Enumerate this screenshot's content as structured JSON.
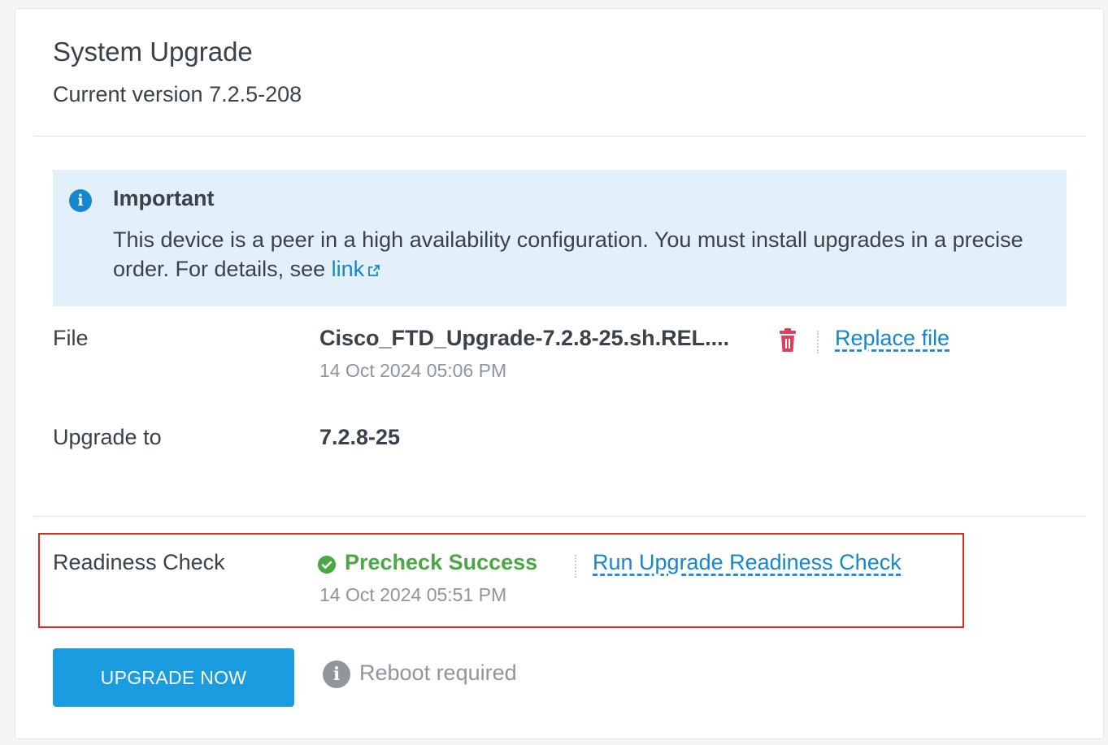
{
  "header": {
    "title": "System Upgrade",
    "current_version": "Current version 7.2.5-208"
  },
  "alert": {
    "title": "Important",
    "body": "This device is a peer in a high availability configuration. You must install upgrades in a precise order. For details, see ",
    "link_text": "link"
  },
  "file": {
    "label": "File",
    "name": "Cisco_FTD_Upgrade-7.2.8-25.sh.REL....",
    "uploaded": "14 Oct 2024 05:06 PM",
    "replace_label": "Replace file"
  },
  "upgrade_to": {
    "label": "Upgrade to",
    "version": "7.2.8-25"
  },
  "readiness": {
    "label": "Readiness Check",
    "status": "Precheck Success",
    "checked": "14 Oct 2024 05:51 PM",
    "run_label": "Run Upgrade Readiness Check"
  },
  "actions": {
    "upgrade_button": "UPGRADE NOW",
    "reboot_note": "Reboot required"
  },
  "colors": {
    "accent": "#1487cf",
    "button": "#1b9be0",
    "success": "#4aa844",
    "danger": "#d9415e",
    "highlight": "#e0291f"
  }
}
